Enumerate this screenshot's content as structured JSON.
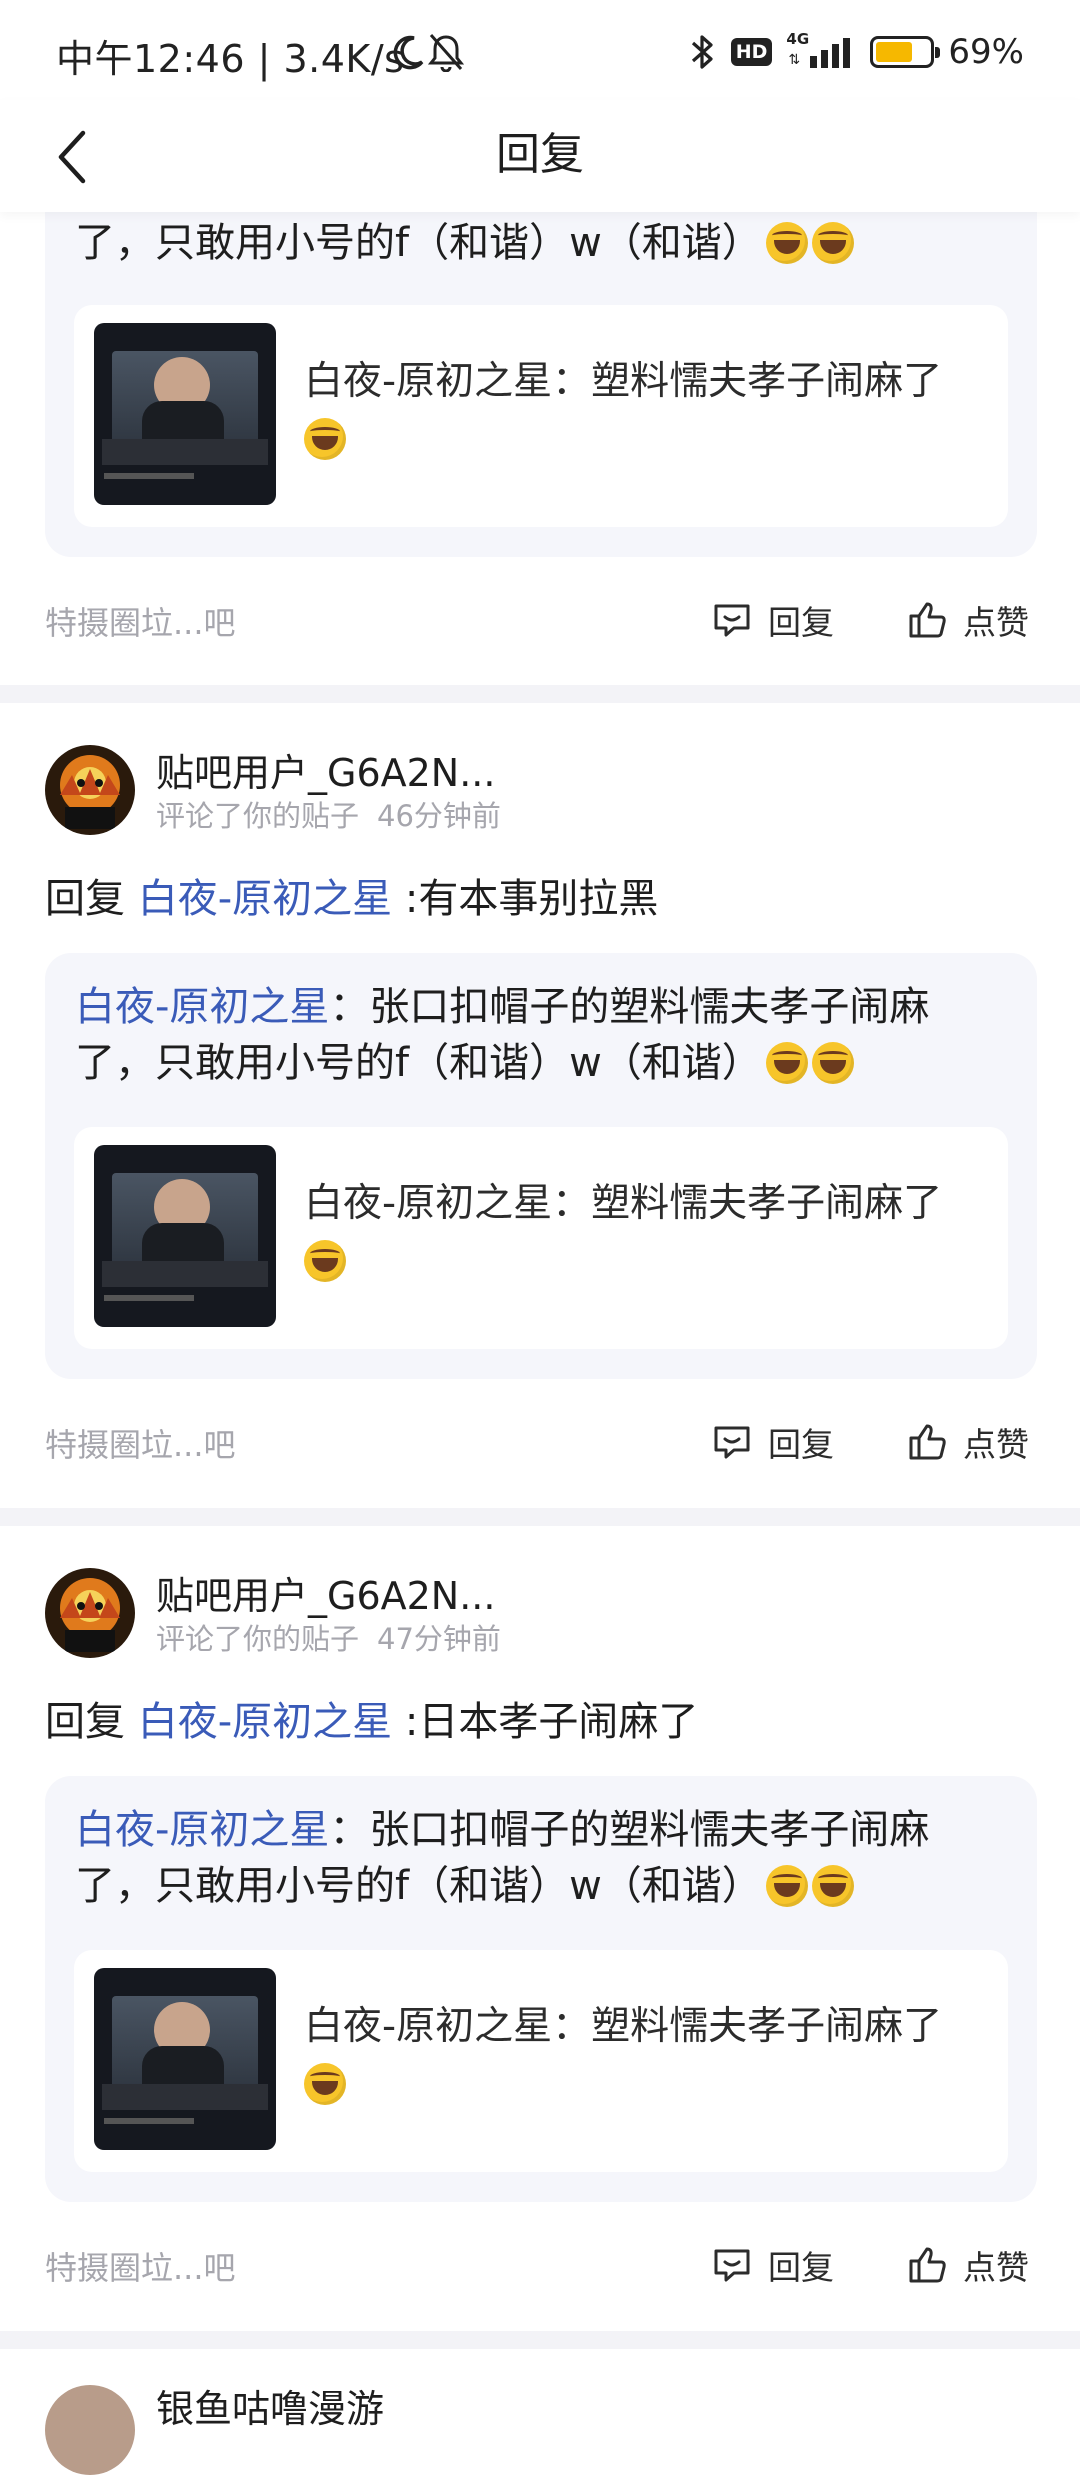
{
  "status_bar": {
    "time": "中午12:46 | 3.4K/s",
    "network_label": "HD",
    "signal_label": "4G",
    "battery_percent": "69%",
    "battery_level": 0.69,
    "battery_color": "#f6b800"
  },
  "nav": {
    "title": "回复",
    "back_icon": "back-arrow-icon"
  },
  "colors": {
    "link": "#3a5bb8",
    "quote_bg": "#f5f6fb",
    "meta": "#a6a6ad"
  },
  "items": [
    {
      "quote": {
        "partial_line": "了，只敢用小号的f（和谐）w（和谐）",
        "inner_text": "白夜-原初之星：塑料懦夫孝子闹麻了"
      },
      "forum": "特摄圈垃...吧",
      "reply_label": "回复",
      "like_label": "点赞"
    },
    {
      "username": "贴吧用户_G6A2N...",
      "action": "评论了你的贴子",
      "time": "46分钟前",
      "reply_prefix": "回复",
      "reply_target": "白夜-原初之星",
      "reply_text": ":有本事别拉黑",
      "quote": {
        "author": "白夜-原初之星",
        "text_line1": "：张口扣帽子的塑料懦夫孝子闹麻",
        "text_line2": "了，只敢用小号的f（和谐）w（和谐）",
        "inner_text": "白夜-原初之星：塑料懦夫孝子闹麻了"
      },
      "forum": "特摄圈垃...吧",
      "reply_label": "回复",
      "like_label": "点赞"
    },
    {
      "username": "贴吧用户_G6A2N...",
      "action": "评论了你的贴子",
      "time": "47分钟前",
      "reply_prefix": "回复",
      "reply_target": "白夜-原初之星",
      "reply_text": ":日本孝子闹麻了",
      "quote": {
        "author": "白夜-原初之星",
        "text_line1": "：张口扣帽子的塑料懦夫孝子闹麻",
        "text_line2": "了，只敢用小号的f（和谐）w（和谐）",
        "inner_text": "白夜-原初之星：塑料懦夫孝子闹麻了"
      },
      "forum": "特摄圈垃...吧",
      "reply_label": "回复",
      "like_label": "点赞"
    },
    {
      "username_partial": "银鱼咕噜漫游"
    }
  ]
}
